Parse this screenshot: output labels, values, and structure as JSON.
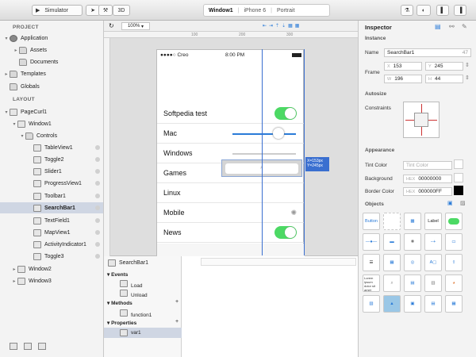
{
  "toolbar": {
    "run_target": "Simulator",
    "view_3d": "3D",
    "window_name": "Window1",
    "device": "iPhone 6",
    "orientation": "Portrait"
  },
  "project": {
    "header": "PROJECT",
    "items": [
      "Application",
      "Assets",
      "Documents",
      "Templates",
      "Globals"
    ]
  },
  "layout": {
    "header": "LAYOUT",
    "items": [
      "PageCurl1",
      "Window1",
      "Controls",
      "TableView1",
      "Toggle2",
      "Slider1",
      "ProgressView1",
      "Toolbar1",
      "SearchBar1",
      "TextField1",
      "MapView1",
      "ActivityIndicator1",
      "Toggle3",
      "Window2",
      "Window3"
    ]
  },
  "canvas": {
    "zoom": "100%",
    "ruler": [
      "100",
      "200",
      "300"
    ],
    "status": {
      "carrier": "Creo",
      "time": "8:00 PM"
    },
    "rows": [
      "Softpedia test",
      "Mac",
      "Windows",
      "Games",
      "Linux",
      "Mobile",
      "News"
    ],
    "coord_readout": {
      "x": "X=153px",
      "y": "Y=245px"
    }
  },
  "bottom": {
    "selected": "SearchBar1",
    "events_header": "Events",
    "events": [
      "Load",
      "Unload"
    ],
    "methods_header": "Methods",
    "methods": [
      "function1"
    ],
    "properties_header": "Properties",
    "properties": [
      "var1"
    ]
  },
  "inspector": {
    "title": "Inspector",
    "instance_header": "Instance",
    "name_label": "Name",
    "name_value": "SearchBar1",
    "name_len": "47",
    "frame_label": "Frame",
    "x_label": "X",
    "x_value": "153",
    "y_label": "Y",
    "y_value": "245",
    "w_label": "W",
    "w_value": "196",
    "h_label": "H",
    "h_value": "44",
    "autosize_header": "Autosize",
    "constraints_label": "Constraints",
    "appearance_header": "Appearance",
    "tint_label": "Tint Color",
    "tint_value": "Tint Color",
    "bg_label": "Background",
    "hex": "HEX",
    "bg_value": "00000000",
    "border_label": "Border Color",
    "border_value": "000000FF",
    "objects_header": "Objects",
    "objects": [
      "Button",
      "Label",
      "Lorem ipsum dolor sit amet"
    ]
  },
  "colors": {
    "accent": "#2a7bd8",
    "toggle_on": "#4cd964",
    "selection": "#cfd6e3"
  }
}
